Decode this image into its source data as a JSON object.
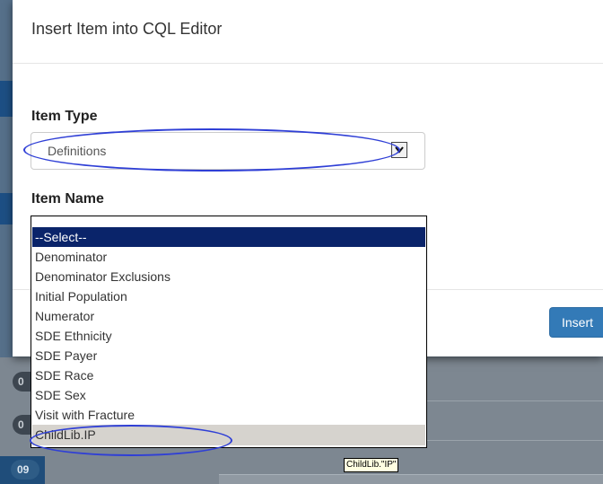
{
  "modal": {
    "title": "Insert Item into CQL Editor",
    "item_type_label": "Item Type",
    "item_type_value": "Definitions",
    "item_name_label": "Item Name",
    "insert_label": "Insert"
  },
  "item_name_list": {
    "options": [
      "--Select--",
      "Denominator",
      "Denominator Exclusions",
      "Initial Population",
      "Numerator",
      "SDE Ethnicity",
      "SDE Payer",
      "SDE Race",
      "SDE Sex",
      "Visit with Fracture",
      "ChildLib.IP"
    ],
    "selected_option": "--Select--",
    "hovered_option": "ChildLib.IP"
  },
  "tooltip": "ChildLib.\"IP\"",
  "background": {
    "badges": [
      "0",
      "0",
      "09"
    ]
  },
  "colors": {
    "primary": "#337ab7",
    "annotation": "#2f3fd6",
    "selected_row": "#0a246a"
  }
}
